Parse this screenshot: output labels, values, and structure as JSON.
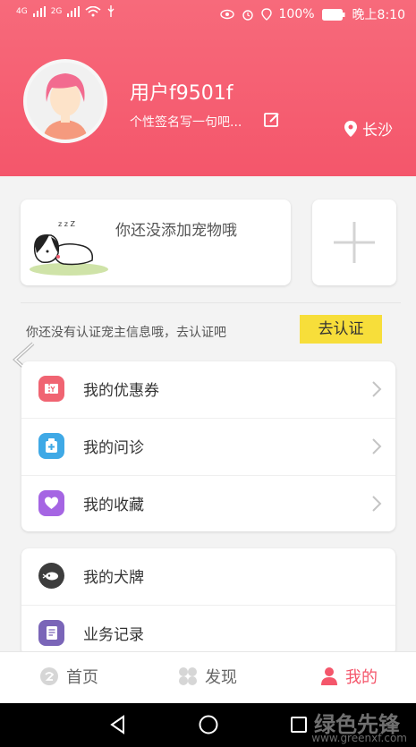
{
  "status_bar": {
    "signal_1": "4G",
    "signal_2": "2G",
    "battery": "100%",
    "time": "晚上8:10"
  },
  "profile": {
    "username": "用户f9501f",
    "signature": "个性签名写一句吧...",
    "location": "长沙"
  },
  "pet": {
    "empty_text": "你还没添加宠物哦"
  },
  "verify": {
    "prompt": "你还没有认证宠主信息哦，去认证吧",
    "button": "去认证"
  },
  "menu": {
    "group1": [
      {
        "label": "我的优惠券",
        "icon": "coupon-icon",
        "color": "#f06472"
      },
      {
        "label": "我的问诊",
        "icon": "medical-icon",
        "color": "#3fa9e6"
      },
      {
        "label": "我的收藏",
        "icon": "heart-icon",
        "color": "#a565e3"
      }
    ],
    "group2": [
      {
        "label": "我的犬牌",
        "icon": "dog-tag-icon",
        "color": "#3d3d3d"
      },
      {
        "label": "业务记录",
        "icon": "record-icon",
        "color": "#7a65b8"
      }
    ]
  },
  "tabs": {
    "home": "首页",
    "discover": "发现",
    "mine": "我的"
  },
  "watermark": {
    "text": "绿色先锋",
    "url": "www.greenxf.com"
  },
  "colors": {
    "header": "#f4566b",
    "accent": "#f4566b",
    "verify_button": "#f7de3a"
  }
}
